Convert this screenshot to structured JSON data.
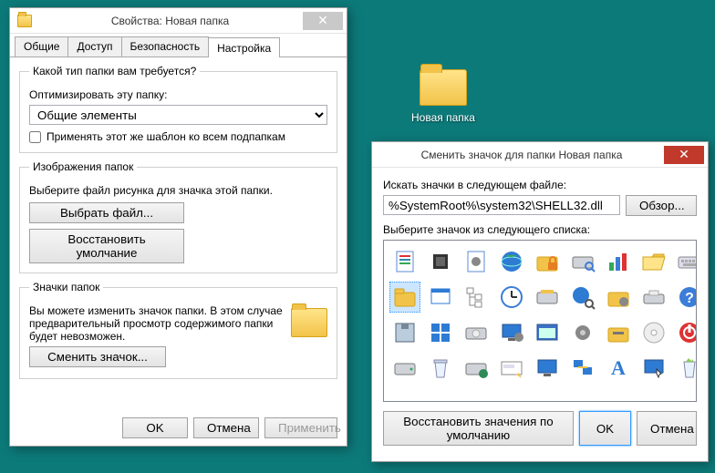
{
  "desktop": {
    "folder_label": "Новая папка"
  },
  "props_window": {
    "title": "Свойства: Новая папка",
    "tabs": [
      "Общие",
      "Доступ",
      "Безопасность",
      "Настройка"
    ],
    "active_tab": 3,
    "group1": {
      "legend": "Какой тип папки вам требуется?",
      "optimize_label": "Оптимизировать эту папку:",
      "combo_selected": "Общие элементы",
      "checkbox_label": "Применять этот же шаблон ко всем подпапкам",
      "checkbox_checked": false
    },
    "group2": {
      "legend": "Изображения папок",
      "desc": "Выберите файл рисунка для значка этой папки.",
      "choose_btn": "Выбрать файл...",
      "restore_btn": "Восстановить умолчание"
    },
    "group3": {
      "legend": "Значки папок",
      "desc": "Вы можете изменить значок папки. В этом случае предварительный просмотр содержимого папки будет невозможен.",
      "change_btn": "Сменить значок..."
    },
    "ok_btn": "OK",
    "cancel_btn": "Отмена",
    "apply_btn": "Применить"
  },
  "change_icon_window": {
    "title": "Сменить значок для папки Новая папка",
    "search_label": "Искать значки в следующем файле:",
    "path_value": "%SystemRoot%\\system32\\SHELL32.dll",
    "browse_btn": "Обзор...",
    "list_label": "Выберите значок из следующего списка:",
    "restore_btn": "Восстановить значения по умолчанию",
    "ok_btn": "OK",
    "cancel_btn": "Отмена",
    "selected_index": 1,
    "icons": [
      "doc-icon",
      "folder-icon",
      "drive-floppy",
      "drive-hard",
      "chip-icon",
      "window-icon",
      "windows-logo",
      "recycle-empty",
      "doc-gear",
      "tree-icon",
      "drive-cd",
      "drive-net",
      "globe-icon",
      "clock-icon",
      "monitor-gear",
      "run-dialog",
      "folder-locked",
      "drive-removable",
      "app-window",
      "display-icon",
      "drive-search",
      "globe-search",
      "gear-small",
      "network-pc",
      "chart-icon",
      "folder-gear",
      "tool-folder",
      "font-icon",
      "folder-open",
      "drive-open",
      "cd-disc",
      "monitor-cursor",
      "keyboard-icon",
      "help-icon",
      "power-icon",
      "recycle-full",
      "folder-shared",
      "drive-small"
    ]
  }
}
